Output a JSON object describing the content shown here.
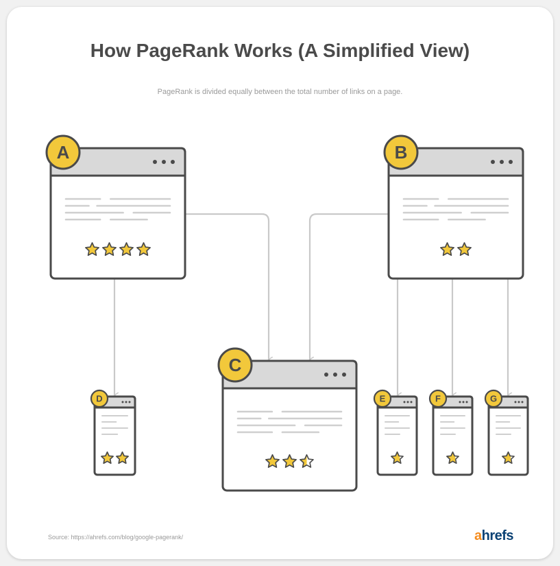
{
  "title": "How PageRank Works (A Simplified View)",
  "subtitle": "PageRank is divided equally between the total number of links on a page.",
  "source": "Source: https://ahrefs.com/blog/google-pagerank/",
  "logo": {
    "first": "a",
    "rest": "hrefs"
  },
  "colors": {
    "badge": "#f2c83b",
    "star": "#f2c83b",
    "outline": "#4a4a4a",
    "header": "#d9d9d9",
    "arrow": "#c9c9c9",
    "textline": "#cfcfcf"
  },
  "pages": [
    {
      "label": "A",
      "stars": 4,
      "type": "full"
    },
    {
      "label": "B",
      "stars": 2,
      "type": "full"
    },
    {
      "label": "C",
      "stars": 2.5,
      "type": "full"
    },
    {
      "label": "D",
      "stars": 2,
      "type": "partial"
    },
    {
      "label": "E",
      "stars": 0.67,
      "type": "partial"
    },
    {
      "label": "F",
      "stars": 0.67,
      "type": "partial"
    },
    {
      "label": "G",
      "stars": 0.67,
      "type": "partial"
    }
  ],
  "links": [
    {
      "from": "A",
      "to": "C"
    },
    {
      "from": "A",
      "to": "D"
    },
    {
      "from": "B",
      "to": "C"
    },
    {
      "from": "B",
      "to": "E"
    },
    {
      "from": "B",
      "to": "F"
    },
    {
      "from": "B",
      "to": "G"
    }
  ]
}
